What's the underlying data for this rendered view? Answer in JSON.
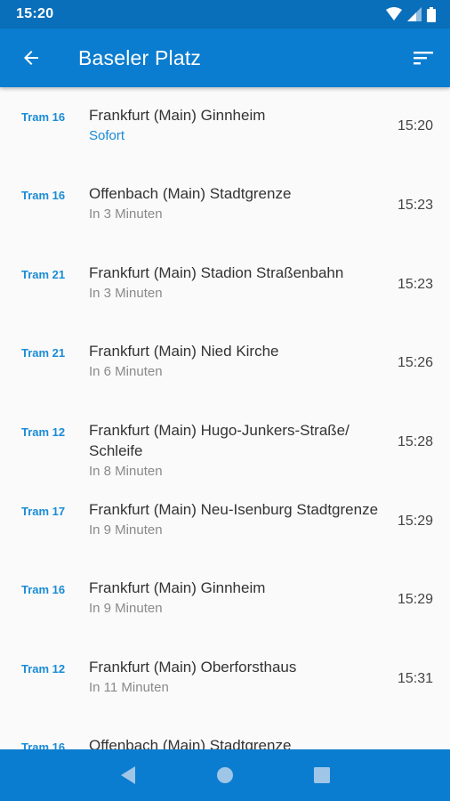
{
  "status_bar": {
    "time": "15:20"
  },
  "app_bar": {
    "title": "Baseler Platz"
  },
  "departures": [
    {
      "line": "Tram 16",
      "destination": "Frankfurt (Main) Ginnheim",
      "info": "Sofort",
      "time": "15:20"
    },
    {
      "line": "Tram 16",
      "destination": "Offenbach (Main) Stadtgrenze",
      "info": "In 3 Minuten",
      "time": "15:23"
    },
    {
      "line": "Tram 21",
      "destination": "Frankfurt (Main) Stadion Straßenbahn",
      "info": "In 3 Minuten",
      "time": "15:23"
    },
    {
      "line": "Tram 21",
      "destination": "Frankfurt (Main) Nied Kirche",
      "info": "In 6 Minuten",
      "time": "15:26"
    },
    {
      "line": "Tram 12",
      "destination": "Frankfurt (Main) Hugo-Junkers-Straße/ Schleife",
      "info": "In 8 Minuten",
      "time": "15:28"
    },
    {
      "line": "Tram 17",
      "destination": "Frankfurt (Main) Neu-Isenburg Stadtgrenze",
      "info": "In 9 Minuten",
      "time": "15:29"
    },
    {
      "line": "Tram 16",
      "destination": "Frankfurt (Main) Ginnheim",
      "info": "In 9 Minuten",
      "time": "15:29"
    },
    {
      "line": "Tram 12",
      "destination": "Frankfurt (Main) Oberforsthaus",
      "info": "In 11 Minuten",
      "time": "15:31"
    },
    {
      "line": "Tram 16",
      "destination": "Offenbach (Main) Stadtgrenze",
      "info": "",
      "time": ""
    }
  ],
  "colors": {
    "primary": "#0b7dd0",
    "status_bar": "#0a6fba",
    "accent": "#1a8bd6",
    "background": "#fafafa"
  },
  "icons": {
    "back": "arrow-left-icon",
    "sort": "sort-icon",
    "wifi": "wifi-icon",
    "signal": "signal-icon",
    "battery": "battery-icon",
    "nav_back": "triangle-back-icon",
    "nav_home": "circle-home-icon",
    "nav_recents": "square-recents-icon"
  }
}
